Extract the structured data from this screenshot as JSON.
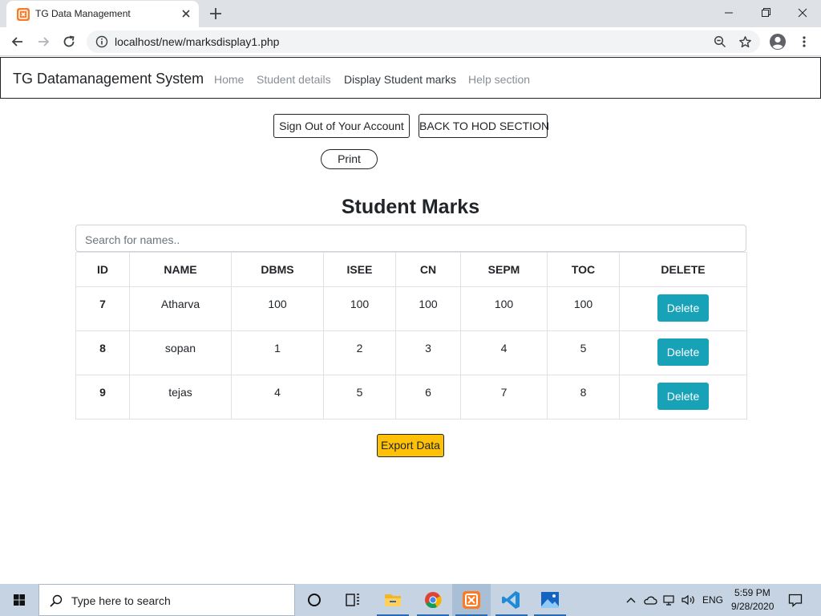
{
  "browser": {
    "tab_title": "TG Data Management",
    "url": "localhost/new/marksdisplay1.php"
  },
  "navbar": {
    "brand": "TG Datamanagement System",
    "links": [
      {
        "label": "Home",
        "active": false
      },
      {
        "label": "Student details",
        "active": false
      },
      {
        "label": "Display Student marks",
        "active": true
      },
      {
        "label": "Help section",
        "active": false
      }
    ]
  },
  "actions": {
    "sign_out": "Sign Out of Your Account",
    "back_hod": "BACK TO HOD SECTION",
    "print": "Print"
  },
  "page": {
    "title": "Student Marks",
    "search_placeholder": "Search for names.."
  },
  "table": {
    "columns": [
      "ID",
      "NAME",
      "DBMS",
      "ISEE",
      "CN",
      "SEPM",
      "TOC",
      "DELETE"
    ],
    "rows": [
      {
        "id": "7",
        "name": "Atharva",
        "dbms": "100",
        "isee": "100",
        "cn": "100",
        "sepm": "100",
        "toc": "100",
        "action": "Delete"
      },
      {
        "id": "8",
        "name": "sopan",
        "dbms": "1",
        "isee": "2",
        "cn": "3",
        "sepm": "4",
        "toc": "5",
        "action": "Delete"
      },
      {
        "id": "9",
        "name": "tejas",
        "dbms": "4",
        "isee": "5",
        "cn": "6",
        "sepm": "7",
        "toc": "8",
        "action": "Delete"
      }
    ]
  },
  "export_label": "Export Data",
  "taskbar": {
    "search_placeholder": "Type here to search",
    "language": "ENG",
    "time": "5:59 PM",
    "date": "9/28/2020",
    "icons": [
      "task-view-icon",
      "file-explorer-icon",
      "chrome-icon",
      "xampp-icon",
      "vscode-icon",
      "photos-icon"
    ]
  },
  "colors": {
    "delete_button": "#17a2b8",
    "export_button": "#ffc107",
    "favicon": "#fb7a24",
    "taskbar": "#c5d3e3"
  }
}
